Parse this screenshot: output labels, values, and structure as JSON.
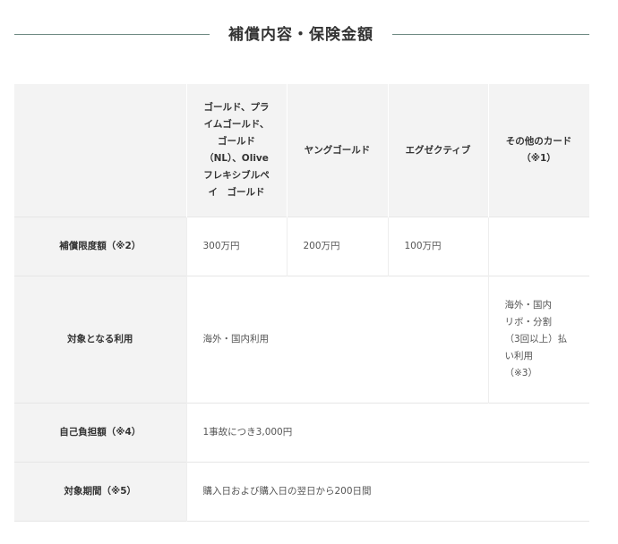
{
  "section_title": "補償内容・保険金額",
  "columns": [
    "",
    "ゴールド、プラ\nイムゴールド、\nゴールド\n（NL）、Olive\nフレキシブルペ\nイ　ゴールド",
    "ヤングゴールド",
    "エグゼクティブ",
    "その他のカード\n（※1）"
  ],
  "rows": {
    "limit": {
      "label": "補償限度額（※2）",
      "values": [
        "300万円",
        "200万円",
        "100万円",
        ""
      ]
    },
    "usage": {
      "label": "対象となる利用",
      "main": "海外・国内利用",
      "other": "海外・国内\nリボ・分割\n（3回以上）払\nい利用\n（※3）"
    },
    "deductible": {
      "label": "自己負担額（※4）",
      "value": "1事故につき3,000円"
    },
    "period": {
      "label": "対象期間（※5）",
      "value": "購入日および購入日の翌日から200日間"
    }
  }
}
